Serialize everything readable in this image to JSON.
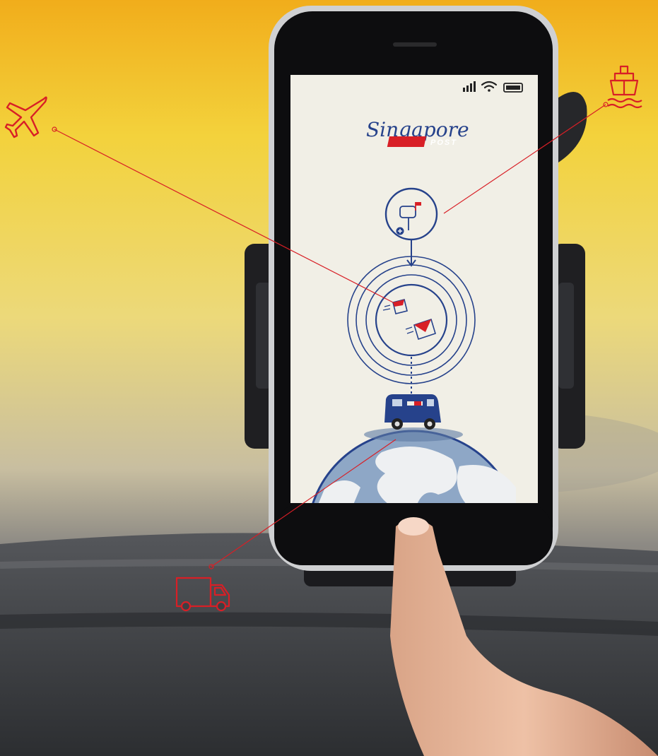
{
  "app": {
    "brand_name": "Singapore",
    "brand_tag": "POST"
  },
  "icons": {
    "signal": "cellular-signal-icon",
    "wifi": "wifi-icon",
    "battery": "battery-icon",
    "mailbox": "mailbox-icon",
    "parcel": "parcel-icon",
    "envelope": "envelope-icon",
    "van": "delivery-van-icon",
    "globe": "globe-icon",
    "plane": "airplane-icon",
    "ship": "ship-icon",
    "truck": "truck-icon"
  },
  "colors": {
    "accent_red": "#d81f26",
    "brand_blue": "#26428b",
    "screen_bg": "#f1efe6",
    "sky_top": "#f1b21c",
    "sky_mid": "#f2d63c"
  }
}
